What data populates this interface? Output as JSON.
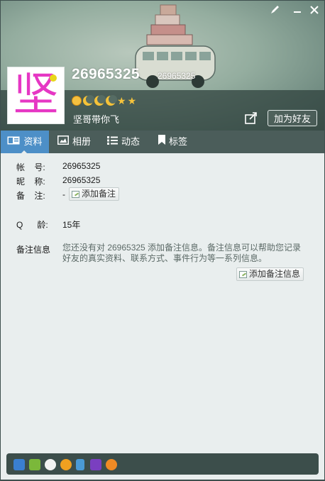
{
  "window": {
    "pen_icon": "pen-icon",
    "close_icon": "close-icon"
  },
  "header": {
    "avatar_text": "坚",
    "nickname": "26965325",
    "nickname_small": "26965325",
    "signature": "坚哥带你飞",
    "add_friend_label": "加为好友",
    "level_icons": [
      "sun",
      "moon",
      "moon",
      "moon",
      "star",
      "star"
    ]
  },
  "tabs": [
    {
      "label": "资料",
      "icon": "profile-card-icon",
      "active": true
    },
    {
      "label": "相册",
      "icon": "photo-icon",
      "active": false
    },
    {
      "label": "动态",
      "icon": "list-icon",
      "active": false
    },
    {
      "label": "标签",
      "icon": "bookmark-icon",
      "active": false
    }
  ],
  "info": {
    "account_label": "帐    号:",
    "account_value": "26965325",
    "nick_label": "昵    称:",
    "nick_value": "26965325",
    "remark_label": "备    注:",
    "remark_value": "-",
    "add_remark_label": "添加备注",
    "qage_label": "Q      龄:",
    "qage_value": "15年",
    "remark_info_label": "备注信息",
    "remark_info_desc": "您还没有对 26965325 添加备注信息。备注信息可以帮助您记录好友的真实资料、联系方式、事件行为等一系列信息。",
    "add_remark_info_label": "添加备注信息"
  },
  "bottom_icons": [
    "contact-card-icon",
    "plant-icon",
    "cow-icon",
    "qq-penguin-icon",
    "phone-icon",
    "wizard-icon",
    "pet-icon"
  ]
}
